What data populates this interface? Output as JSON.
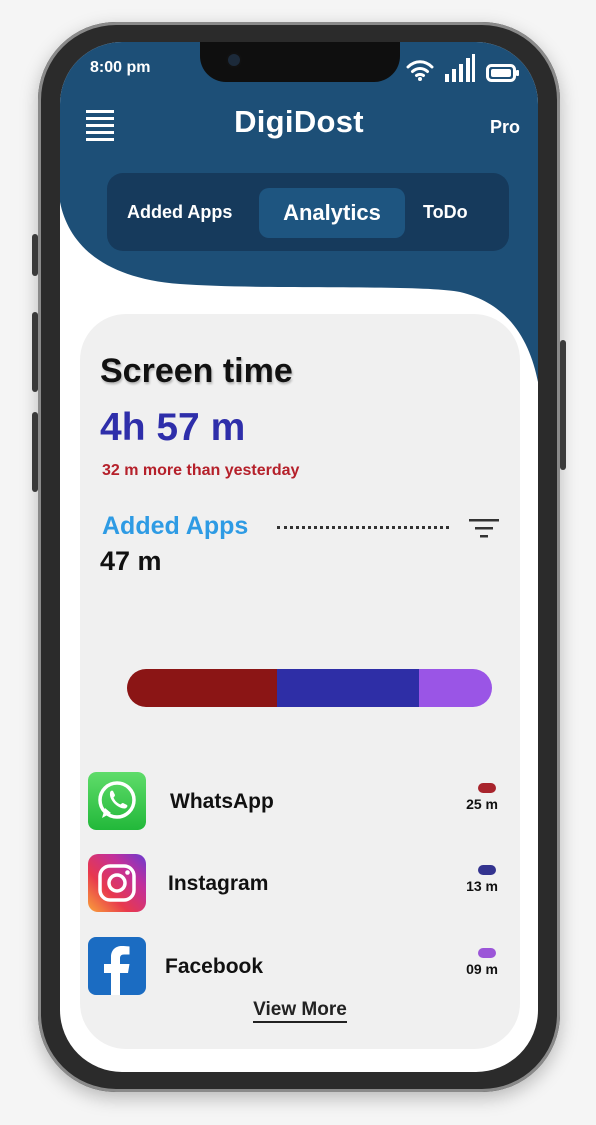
{
  "status_bar": {
    "time": "8:00 pm"
  },
  "header": {
    "title": "DigiDost",
    "pro_label": "Pro",
    "tabs": [
      {
        "label": "Added Apps",
        "active": false
      },
      {
        "label": "Analytics",
        "active": true
      },
      {
        "label": "ToDo",
        "active": false
      }
    ]
  },
  "screen_time": {
    "title": "Screen time",
    "value": "4h 57 m",
    "delta_text": "32 m more than yesterday"
  },
  "added_apps": {
    "label": "Added Apps",
    "total": "47 m",
    "bar_segments": [
      {
        "app": "WhatsApp",
        "fraction": 0.41,
        "color": "#8b1515"
      },
      {
        "app": "Instagram",
        "fraction": 0.39,
        "color": "#2e2ea6"
      },
      {
        "app": "Facebook",
        "fraction": 0.2,
        "color": "#9a55e6"
      }
    ]
  },
  "apps": [
    {
      "name": "WhatsApp",
      "time": "25 m",
      "color": "#a8242c",
      "icon": "whatsapp-icon"
    },
    {
      "name": "Instagram",
      "time": "13 m",
      "color": "#33338f",
      "icon": "instagram-icon"
    },
    {
      "name": "Facebook",
      "time": "09 m",
      "color": "#9b55d8",
      "icon": "facebook-icon"
    }
  ],
  "view_more": "View More",
  "colors": {
    "header": "#1d4f77",
    "tab_bar": "#163a5c",
    "active_tab": "#1e5580",
    "screen_time_value": "#2e2eaa",
    "delta": "#b5202a",
    "added_label": "#2e9be4"
  }
}
